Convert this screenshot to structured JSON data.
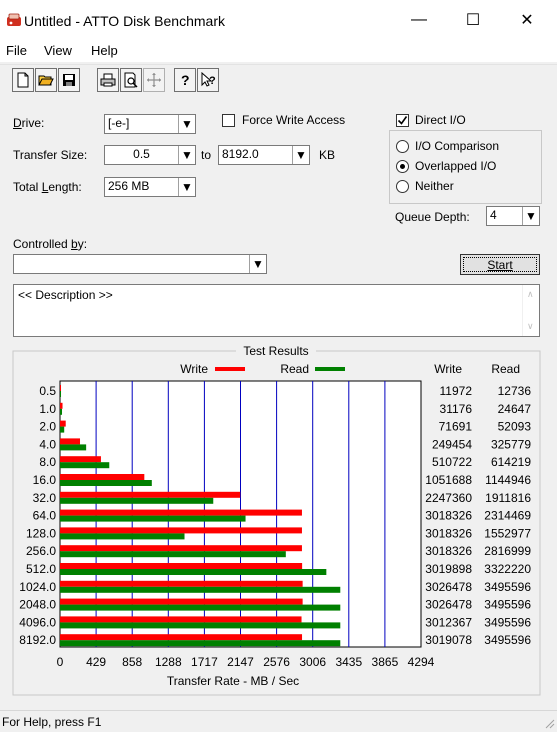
{
  "window": {
    "title": "Untitled - ATTO Disk Benchmark",
    "min_glyph": "—",
    "max_glyph": "☐",
    "close_glyph": "✕"
  },
  "menu": {
    "file": "File",
    "view": "View",
    "help": "Help"
  },
  "toolbar_icons": [
    "new-icon",
    "open-icon",
    "save-icon",
    "print-icon",
    "print-preview-icon",
    "move-icon",
    "help-icon",
    "context-help-icon"
  ],
  "form": {
    "drive_label": "Drive:",
    "drive_value": "[-e-]",
    "force_write_label": "Force Write Access",
    "force_write_checked": false,
    "transfer_size_label": "Transfer Size:",
    "transfer_from": "0.5",
    "to_label": "to",
    "transfer_to": "8192.0",
    "kb_label": "KB",
    "total_length_label": "Total Length:",
    "total_length_value": "256 MB",
    "direct_io_label": "Direct I/O",
    "direct_io_checked": true,
    "io_comparison_label": "I/O Comparison",
    "overlapped_io_label": "Overlapped I/O",
    "neither_label": "Neither",
    "selected_mode": "overlapped",
    "queue_depth_label": "Queue Depth:",
    "queue_depth_value": "4",
    "controlled_by_label": "Controlled by:",
    "controlled_by_value": "",
    "start_label": "Start",
    "description_text": "<< Description >>"
  },
  "results": {
    "group_title": "Test Results",
    "legend_write": "Write",
    "legend_read": "Read",
    "col_write": "Write",
    "col_read": "Read",
    "write_color": "#ff0000",
    "read_color": "#008000",
    "grid_color": "#0000c0",
    "xlabel": "Transfer Rate - MB / Sec",
    "rows": [
      {
        "size": "0.5",
        "write": "11972",
        "read": "12736"
      },
      {
        "size": "1.0",
        "write": "31176",
        "read": "24647"
      },
      {
        "size": "2.0",
        "write": "71691",
        "read": "52093"
      },
      {
        "size": "4.0",
        "write": "249454",
        "read": "325779"
      },
      {
        "size": "8.0",
        "write": "510722",
        "read": "614219"
      },
      {
        "size": "16.0",
        "write": "1051688",
        "read": "1144946"
      },
      {
        "size": "32.0",
        "write": "2247360",
        "read": "1911816"
      },
      {
        "size": "64.0",
        "write": "3018326",
        "read": "2314469"
      },
      {
        "size": "128.0",
        "write": "3018326",
        "read": "1552977"
      },
      {
        "size": "256.0",
        "write": "3018326",
        "read": "2816999"
      },
      {
        "size": "512.0",
        "write": "3019898",
        "read": "3322220"
      },
      {
        "size": "1024.0",
        "write": "3026478",
        "read": "3495596"
      },
      {
        "size": "2048.0",
        "write": "3026478",
        "read": "3495596"
      },
      {
        "size": "4096.0",
        "write": "3012367",
        "read": "3495596"
      },
      {
        "size": "8192.0",
        "write": "3019078",
        "read": "3495596"
      }
    ]
  },
  "chart_data": {
    "type": "bar",
    "orientation": "horizontal",
    "title": "Test Results",
    "xlabel": "Transfer Rate - MB / Sec",
    "ylabel": "",
    "xticks": [
      "0",
      "429",
      "858",
      "1288",
      "1717",
      "2147",
      "2576",
      "3006",
      "3435",
      "3865",
      "4294"
    ],
    "xlim": [
      0,
      4294
    ],
    "categories": [
      "0.5",
      "1.0",
      "2.0",
      "4.0",
      "8.0",
      "16.0",
      "32.0",
      "64.0",
      "128.0",
      "256.0",
      "512.0",
      "1024.0",
      "2048.0",
      "4096.0",
      "8192.0"
    ],
    "series": [
      {
        "name": "Write",
        "values": [
          11,
          30,
          68,
          238,
          487,
          1003,
          2143,
          2878,
          2878,
          2878,
          2880,
          2886,
          2886,
          2873,
          2879
        ]
      },
      {
        "name": "Read",
        "values": [
          12,
          24,
          50,
          311,
          586,
          1092,
          1823,
          2207,
          1481,
          2686,
          3168,
          3334,
          3334,
          3334,
          3334
        ]
      }
    ],
    "grid": true,
    "legend": "top"
  },
  "status": {
    "text": "For Help, press F1"
  }
}
